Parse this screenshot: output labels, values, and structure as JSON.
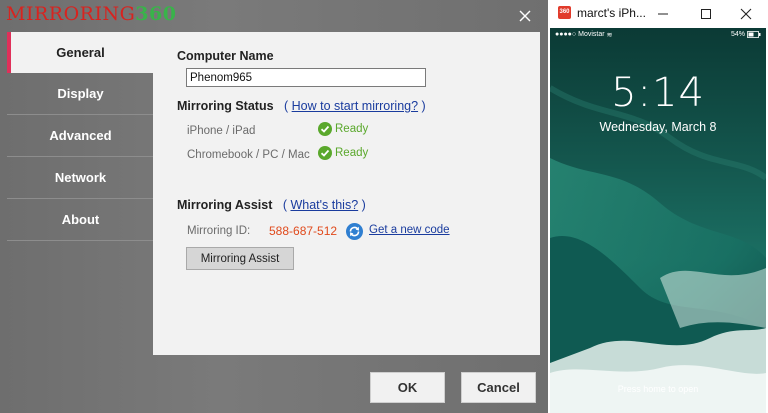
{
  "app": {
    "logo_part1": "MIRRORING",
    "logo_part2": "360",
    "close_icon": "close-icon"
  },
  "nav": {
    "items": [
      {
        "label": "General",
        "active": true
      },
      {
        "label": "Display",
        "active": false
      },
      {
        "label": "Advanced",
        "active": false
      },
      {
        "label": "Network",
        "active": false
      },
      {
        "label": "About",
        "active": false
      }
    ]
  },
  "general": {
    "computer_name_heading": "Computer Name",
    "computer_name_value": "Phenom965",
    "mirroring_status_heading": "Mirroring Status",
    "paren_open": "(",
    "paren_close": ")",
    "how_to_link": "How to start mirroring?",
    "status_rows": [
      {
        "label": "iPhone / iPad",
        "status": "Ready"
      },
      {
        "label": "Chromebook / PC / Mac",
        "status": "Ready"
      }
    ],
    "mirroring_assist_heading": "Mirroring Assist",
    "whats_this_link": "What's this?",
    "mirroring_id_label": "Mirroring ID:",
    "mirroring_id_value": "588-687-512",
    "get_new_code_link": "Get a new code",
    "assist_button": "Mirroring Assist"
  },
  "footer": {
    "ok_label": "OK",
    "cancel_label": "Cancel"
  },
  "phone_window": {
    "title": "marct's iPh...",
    "app_icon_text": "360",
    "controls": [
      "minimize-icon",
      "maximize-icon",
      "close-icon"
    ],
    "status_bar": {
      "carrier": "Movistar",
      "battery": "54%"
    },
    "lock_time": "5:14",
    "lock_date": "Wednesday, March 8",
    "press_home": "Press home to open"
  },
  "colors": {
    "accent": "#e0305a",
    "ready_green": "#5aa82c",
    "id_orange": "#e04a1c",
    "link_blue": "#1a3c9e"
  }
}
